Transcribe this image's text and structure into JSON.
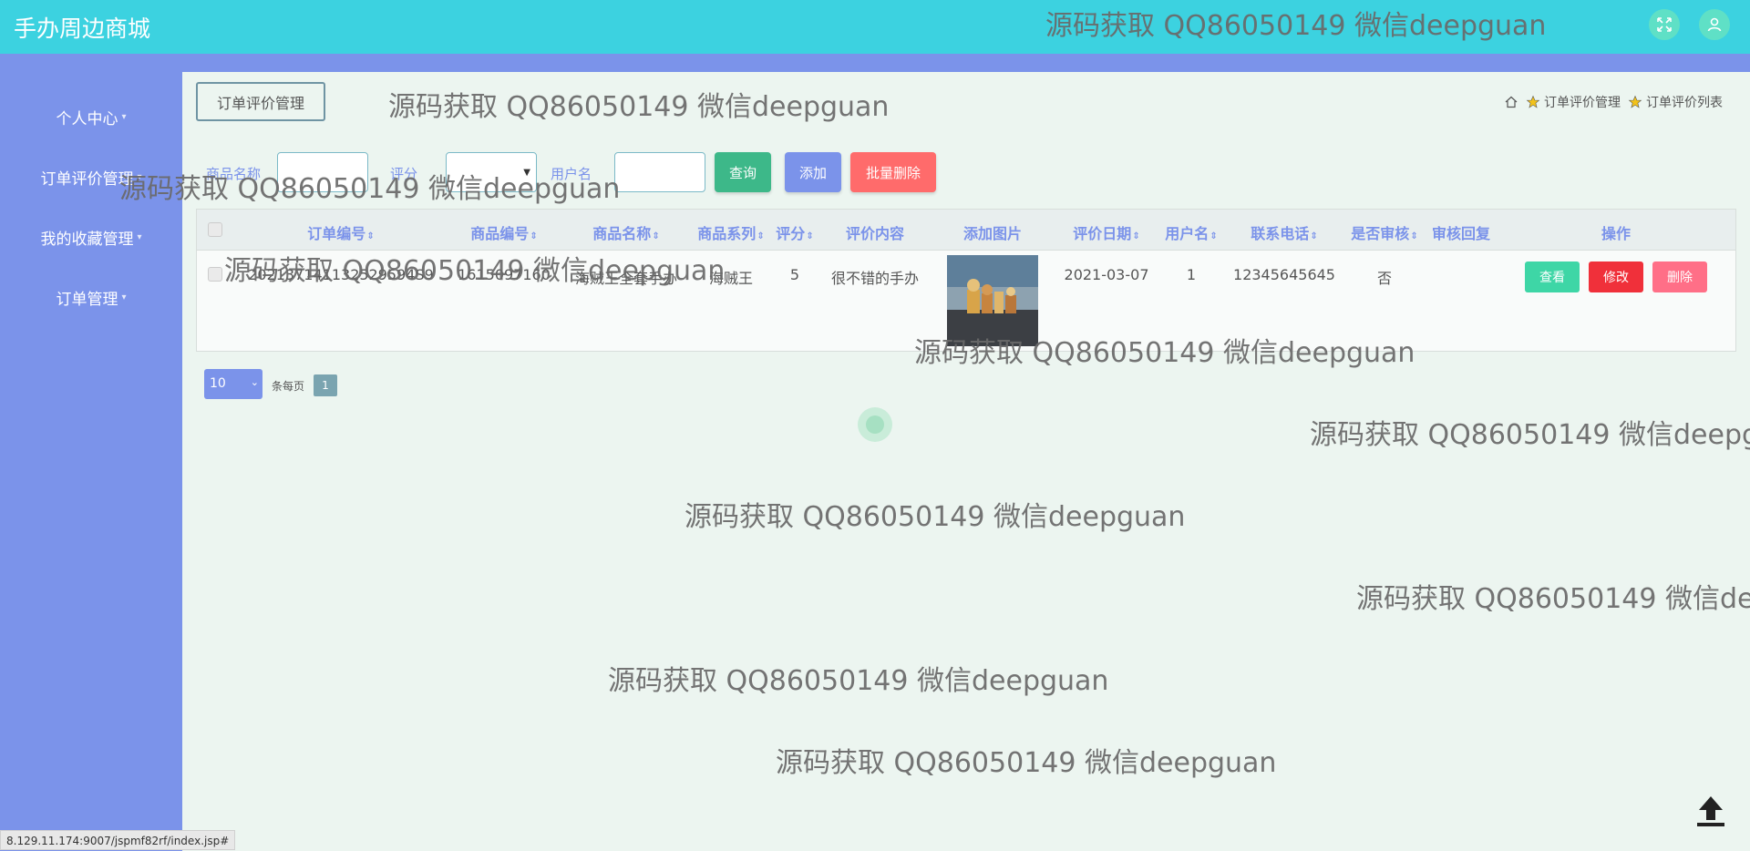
{
  "app": {
    "title": "手办周边商城"
  },
  "topbar": {
    "icons": [
      "fullscreen-icon",
      "user-icon"
    ]
  },
  "sidebar": {
    "items": [
      {
        "label": "个人中心"
      },
      {
        "label": "订单评价管理"
      },
      {
        "label": "我的收藏管理"
      },
      {
        "label": "订单管理"
      }
    ]
  },
  "page": {
    "tag": "订单评价管理",
    "breadcrumb": [
      "订单评价管理",
      "订单评价列表"
    ]
  },
  "search": {
    "fields": [
      {
        "label": "商品名称",
        "value": ""
      },
      {
        "label": "评分",
        "value": ""
      },
      {
        "label": "用户名",
        "value": ""
      }
    ],
    "query_button": "查询",
    "add_button": "添加",
    "batch_delete_button": "批量删除"
  },
  "table": {
    "columns": [
      "订单编号",
      "商品编号",
      "商品名称",
      "商品系列",
      "评分",
      "评价内容",
      "添加图片",
      "评价日期",
      "用户名",
      "联系电话",
      "是否审核",
      "审核回复",
      "操作"
    ],
    "rows": [
      {
        "order_no": "202137141132529594S9",
        "product_no": "1615097160",
        "product_name": "海贼王全套手办",
        "series": "海贼王",
        "rating": "5",
        "content": "很不错的手办",
        "date": "2021-03-07",
        "username": "1",
        "phone": "12345645645",
        "audited": "否",
        "reply": "",
        "actions": {
          "view": "查看",
          "edit": "修改",
          "delete": "删除"
        }
      }
    ]
  },
  "pager": {
    "page_size": "10",
    "per_page_label": "条每页",
    "current_page": "1"
  },
  "watermark": {
    "text": "源码获取 QQ86050149 微信deepguan"
  },
  "status_bar": {
    "url": "8.129.11.174:9007/jspmf82rf/index.jsp#"
  },
  "colors": {
    "topbar": "#3cd2e0",
    "sidebar": "#7b93ea",
    "query": "#3db889",
    "add": "#7b93ea",
    "batch_delete": "#ff6b6b",
    "view": "#3ed6a6",
    "edit": "#f0303a",
    "delete": "#ff6f87"
  }
}
